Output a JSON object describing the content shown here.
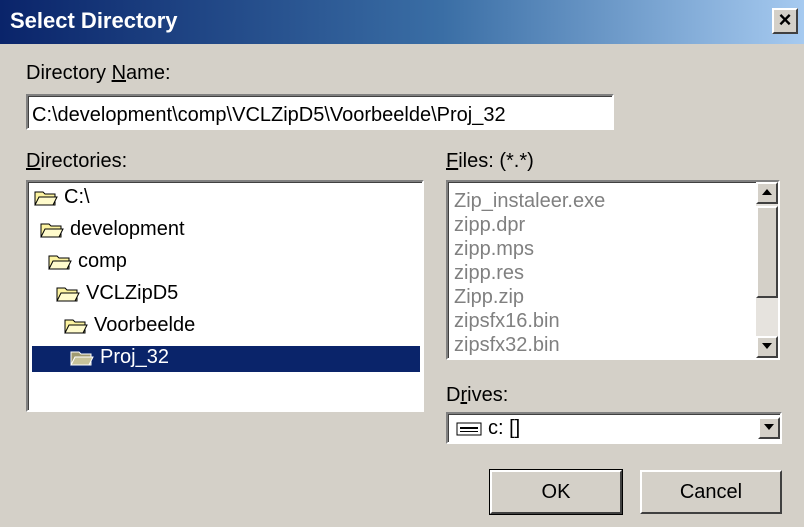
{
  "window": {
    "title": "Select Directory",
    "close_glyph": "×"
  },
  "directory_name": {
    "label_pre": "Directory ",
    "label_key": "N",
    "label_post": "ame:",
    "value": "C:\\development\\comp\\VCLZipD5\\Voorbeelde\\Proj_32"
  },
  "directories": {
    "label_key": "D",
    "label_post": "irectories:",
    "items": [
      {
        "label": "C:\\",
        "icon": "folder-open-icon"
      },
      {
        "label": "development",
        "icon": "folder-open-icon"
      },
      {
        "label": "comp",
        "icon": "folder-open-icon"
      },
      {
        "label": "VCLZipD5",
        "icon": "folder-open-icon"
      },
      {
        "label": "Voorbeelde",
        "icon": "folder-open-icon"
      },
      {
        "label": "Proj_32",
        "icon": "folder-open-icon",
        "selected": true
      }
    ]
  },
  "files": {
    "label_key": "F",
    "label_post": "iles: (*.*)",
    "items": [
      "Zip_instaleer.exe",
      "zipp.dpr",
      "zipp.mps",
      "zipp.res",
      "Zipp.zip",
      "zipsfx16.bin",
      "zipsfx32.bin"
    ]
  },
  "drives": {
    "label_pre": "D",
    "label_key": "r",
    "label_post": "ives:",
    "value": "c: []",
    "icon": "drive-icon"
  },
  "buttons": {
    "ok": "OK",
    "cancel": "Cancel"
  },
  "colors": {
    "titlebar_start": "#0a246a",
    "selection": "#0a246a",
    "face": "#d4d0c8"
  }
}
